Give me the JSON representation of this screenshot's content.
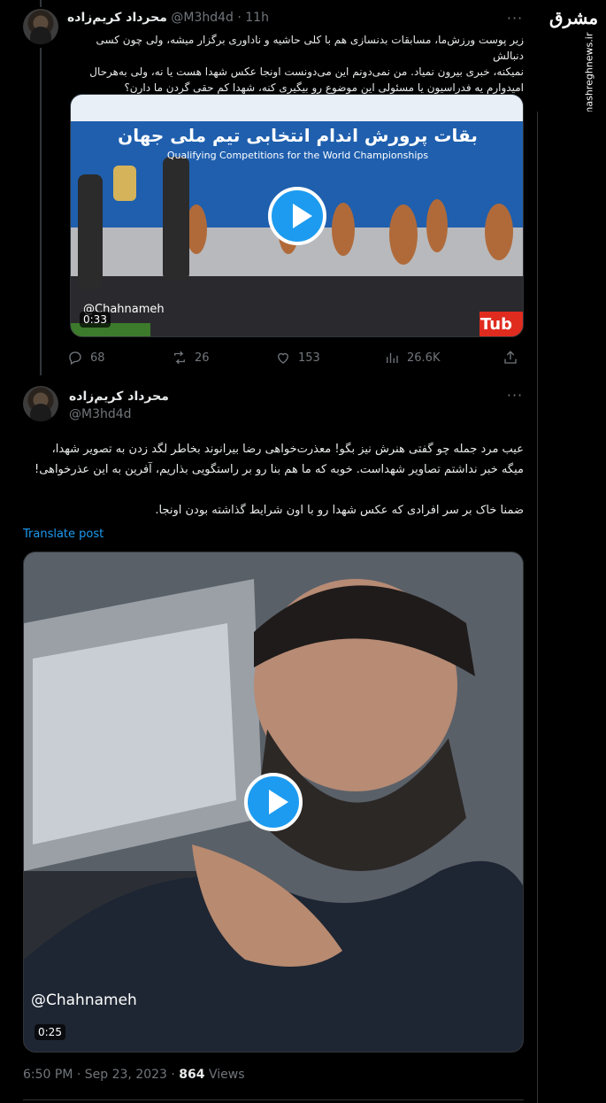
{
  "brand": {
    "logo": "مشرق",
    "url": "mashreghnews.ir"
  },
  "tweet1": {
    "display_name": "محرداد کریم‌زاده",
    "handle": "@M3hd4d",
    "time": "11h",
    "text_lines": [
      "زیر پوست ورزش‌ما، مسابقات بدنسازی هم با کلی حاشیه و ناداوری برگزار میشه، ولی چون کسی دنبالش",
      "نمیکنه، خبری بیرون نمیاد. من نمی‌دونم این          می‌دونست اونجا عکس شهدا هست یا نه، ولی به‌هرحال",
      "امیدوارم یه فدراسیون یا مسئولی این موضوع رو بیگیری کنه، شهدا کم حقی گردن ما دارن؟"
    ],
    "video": {
      "banner_text": "بقات پرورش اندام انتخابی تیم ملی جهان",
      "banner_subtext": "Qualifying Competitions for the World Championships",
      "watermark": "@Chahnameh",
      "duration": "0:33",
      "corner_label": "Tub"
    },
    "stats": {
      "replies": "68",
      "reposts": "26",
      "likes": "153",
      "views": "26.6K"
    }
  },
  "tweet2": {
    "display_name": "محرداد کریم‌زاده",
    "handle": "@M3hd4d",
    "text_lines": [
      "عیب مرد جمله چو گفتی هنرش نیز بگو! معذرت‌خواهی رضا بیرانوند بخاطر لگد زدن به تصویر شهدا،",
      "میگه خبر نداشتم تصاویر شهداست. خوبه که ما هم بنا رو بر راستگویی بذاریم، آفرین به این عذرخواهی!",
      "",
      "ضمنا خاک بر سر افرادی که عکس شهدا رو با اون شرایط گذاشته بودن اونجا."
    ],
    "translate_label": "Translate post",
    "video": {
      "watermark": "@Chahnameh",
      "duration": "0:25"
    },
    "timestamp": "6:50 PM · Sep 23, 2023 · ",
    "views_count": "864",
    "views_label": " Views"
  },
  "colors": {
    "accent": "#1d9bf0",
    "muted": "#71767b",
    "text": "#e7e9ea",
    "border": "#2f3336",
    "background": "#000000"
  }
}
